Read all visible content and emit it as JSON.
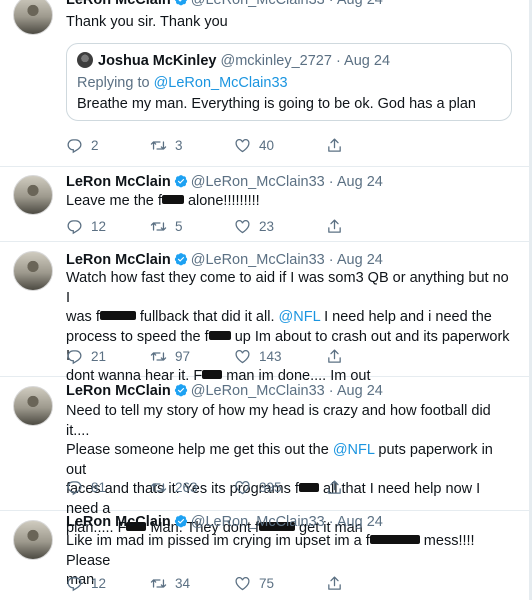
{
  "tweets": [
    {
      "name": "LeRon McClain",
      "handle": "@LeRon_McClain33",
      "sep": "·",
      "date": "Aug 24",
      "text": "Thank you sir. Thank you",
      "quote": {
        "name": "Joshua McKinley",
        "handle": "@mckinley_2727",
        "sep": "·",
        "date": "Aug 24",
        "reply_prefix": "Replying to ",
        "reply_to": "@LeRon_McClain33",
        "text": "Breathe my man. Everything is going to be ok. God has a plan"
      },
      "replies": "2",
      "retweets": "3",
      "likes": "40"
    },
    {
      "name": "LeRon McClain",
      "handle": "@LeRon_McClain33",
      "sep": "·",
      "date": "Aug 24",
      "text_a": "Leave me the f",
      "text_b": " alone!!!!!!!!!",
      "replies": "12",
      "retweets": "5",
      "likes": "23"
    },
    {
      "name": "LeRon McClain",
      "handle": "@LeRon_McClain33",
      "sep": "·",
      "date": "Aug 24",
      "l1": "Watch how fast they come to aid if I was som3 QB or anything but no I",
      "l2a": "was f",
      "l2b": " fullback that did it all. ",
      "l2m": "@NFL",
      "l2c": " I need help and i need the",
      "l3a": "process to speed the f",
      "l3b": " up Im about to crash out and its paperwork I",
      "l4a": "dont wanna hear it. F",
      "l4b": " man im done.... Im out",
      "replies": "21",
      "retweets": "97",
      "likes": "143"
    },
    {
      "name": "LeRon McClain",
      "handle": "@LeRon_McClain33",
      "sep": "·",
      "date": "Aug 24",
      "l1": "Need to tell my story of how my head is crazy and how football did it....",
      "l2a": "Please someone help me get this out the ",
      "l2m": "@NFL",
      "l2b": " puts paperwork in out",
      "l3a": "faces and thats it. Yes its programs f",
      "l3b": " all that I need help now I need a",
      "l4a": "plan..... F",
      "l4b": " Man. They dont f",
      "l4c": " get it man",
      "replies": "81",
      "retweets": "263",
      "likes": "395"
    },
    {
      "name": "LeRon McClain",
      "handle": "@LeRon_McClain33",
      "sep": "·",
      "date": "Aug 24",
      "l1a": "Like im mad im pissed im crying im upset im a f",
      "l1b": " mess!!!! Please",
      "l2": "man",
      "replies": "12",
      "retweets": "34",
      "likes": "75"
    }
  ],
  "colors": {
    "accent": "#1da1f2",
    "muted": "#5b7083",
    "text": "#0f1419",
    "border": "#e6ecf0"
  },
  "icons": [
    "verified-icon",
    "reply-icon",
    "retweet-icon",
    "like-icon",
    "share-icon"
  ]
}
